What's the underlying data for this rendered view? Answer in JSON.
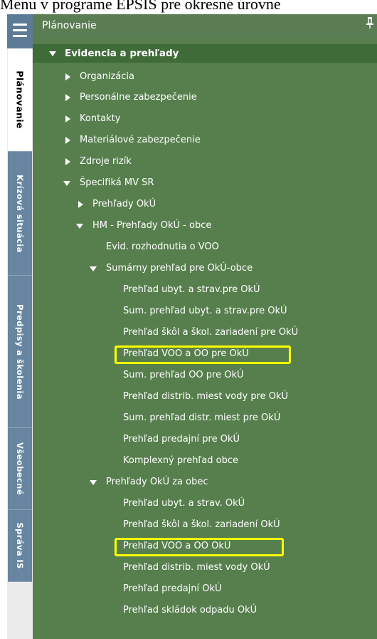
{
  "doc_caption": "Menu v programe EPSIS pre okresné úrovne",
  "side_tabs": [
    {
      "label": "Plánovanie"
    },
    {
      "label": "Krízová situácia"
    },
    {
      "label": "Predpisy a školenia"
    },
    {
      "label": "Všeobecné"
    },
    {
      "label": "Správa IS"
    }
  ],
  "panel": {
    "title": "Plánovanie"
  },
  "tree": [
    {
      "label": "Evidencia a prehľady"
    },
    {
      "label": "Organizácia"
    },
    {
      "label": "Personálne zabezpečenie"
    },
    {
      "label": "Kontakty"
    },
    {
      "label": "Materiálové zabezpečenie"
    },
    {
      "label": "Zdroje rizík"
    },
    {
      "label": "Špecifiká MV SR"
    },
    {
      "label": "Prehľady OkÚ"
    },
    {
      "label": "HM - Prehľady OkÚ - obce"
    },
    {
      "label": "Evid. rozhodnutia o VOO"
    },
    {
      "label": "Sumárny prehľad pre OkÚ-obce"
    },
    {
      "label": "Prehľad ubyt. a strav.pre OkÚ"
    },
    {
      "label": "Sum. prehľad ubyt. a strav.pre OkÚ"
    },
    {
      "label": "Prehľad škôl a škol. zariadení pre OkÚ"
    },
    {
      "label": "Prehľad VOO a OO pre OkÚ"
    },
    {
      "label": "Sum. prehľad OO pre OkÚ"
    },
    {
      "label": "Prehľad distrib. miest vody pre OkÚ"
    },
    {
      "label": "Sum. prehľad distr. miest pre OkÚ"
    },
    {
      "label": "Prehľad predajní pre OkÚ"
    },
    {
      "label": "Komplexný prehľad obce"
    },
    {
      "label": "Prehľady OkÚ za obec"
    },
    {
      "label": "Prehľad ubyt. a strav. OkÚ"
    },
    {
      "label": "Prehľad škôl a škol. zariadení OkÚ"
    },
    {
      "label": "Prehľad VOO a OO OkÚ"
    },
    {
      "label": "Prehľad distrib. miest vody OkÚ"
    },
    {
      "label": "Prehľad predajní OkÚ"
    },
    {
      "label": "Prehľad skládok odpadu OkÚ"
    }
  ]
}
